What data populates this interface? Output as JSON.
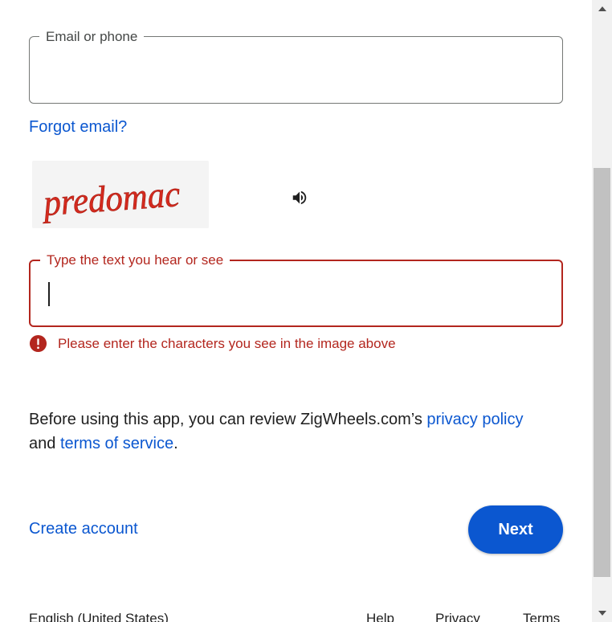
{
  "email_field": {
    "label": "Email or phone",
    "value": ""
  },
  "forgot_email": "Forgot email?",
  "captcha": {
    "image_text": "predomac",
    "audio_icon": "speaker-icon",
    "field_label": "Type the text you hear or see",
    "value": "",
    "error_message": "Please enter the characters you see in the image above",
    "error_icon": "error-icon"
  },
  "disclaimer": {
    "prefix": "Before using this app, you can review ZigWheels.com’s ",
    "privacy_link": "privacy policy",
    "middle": " and ",
    "terms_link": "terms of service",
    "suffix": "."
  },
  "actions": {
    "create_account": "Create account",
    "next": "Next"
  },
  "footer": {
    "language": "English (United States)",
    "help": "Help",
    "privacy": "Privacy",
    "terms": "Terms"
  },
  "colors": {
    "accent": "#0b57d0",
    "error": "#b3261e",
    "captcha_text": "#d42a1e"
  }
}
